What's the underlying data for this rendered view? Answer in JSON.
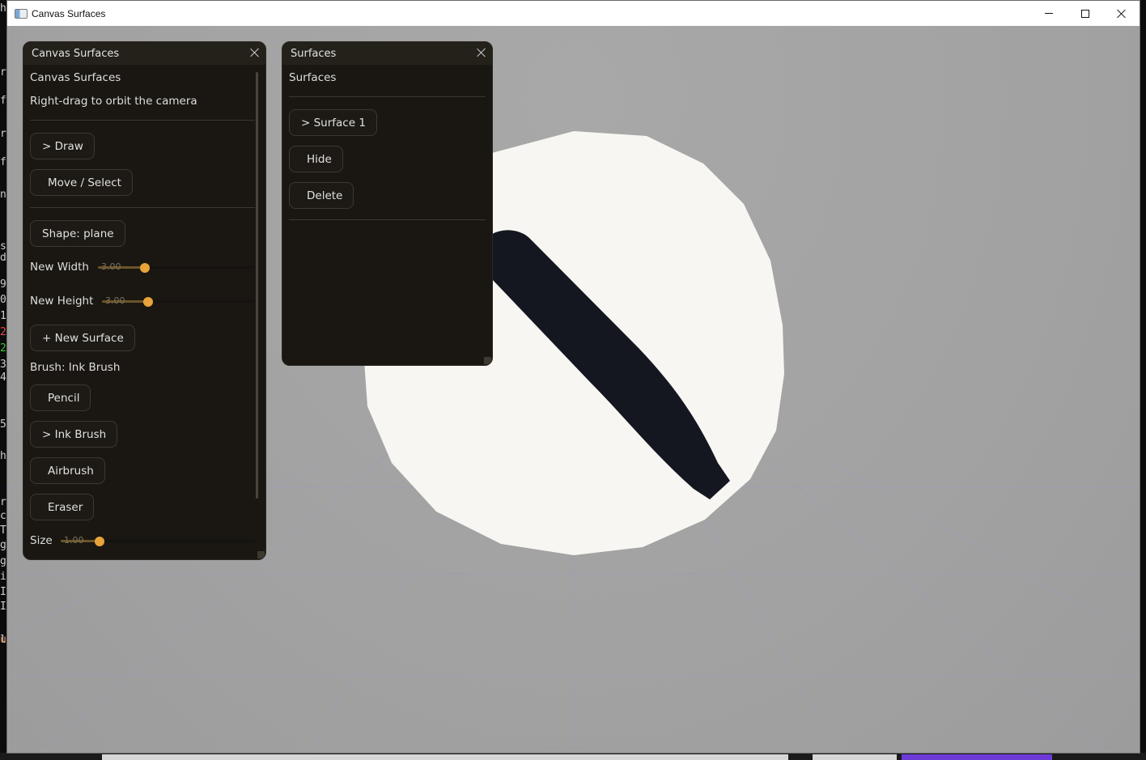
{
  "window": {
    "title": "Canvas Surfaces"
  },
  "background_terminal": {
    "glyphs": [
      {
        "text": "h",
        "color": "#cfcfcf"
      },
      {
        "text": "r",
        "color": "#cfcfcf"
      },
      {
        "text": "f",
        "color": "#cfcfcf"
      },
      {
        "text": "r",
        "color": "#cfcfcf"
      },
      {
        "text": "f",
        "color": "#cfcfcf"
      },
      {
        "text": "n",
        "color": "#cfcfcf"
      },
      {
        "text": "s",
        "color": "#cfcfcf"
      },
      {
        "text": "d",
        "color": "#cfcfcf"
      },
      {
        "text": "9",
        "color": "#cfcfcf"
      },
      {
        "text": "0",
        "color": "#cfcfcf"
      },
      {
        "text": "1",
        "color": "#cfcfcf"
      },
      {
        "text": "2",
        "color": "#e24b4b"
      },
      {
        "text": "2",
        "color": "#37c837"
      },
      {
        "text": "3",
        "color": "#cfcfcf"
      },
      {
        "text": "4",
        "color": "#cfcfcf"
      },
      {
        "text": "5",
        "color": "#cfcfcf"
      },
      {
        "text": "h",
        "color": "#cfcfcf"
      },
      {
        "text": "r",
        "color": "#cfcfcf"
      },
      {
        "text": "c",
        "color": "#cfcfcf"
      },
      {
        "text": "T",
        "color": "#cfcfcf"
      },
      {
        "text": "g",
        "color": "#cfcfcf"
      },
      {
        "text": "g",
        "color": "#cfcfcf"
      },
      {
        "text": "i",
        "color": "#cfcfcf"
      },
      {
        "text": "I",
        "color": "#cfcfcf"
      },
      {
        "text": "I",
        "color": "#cfcfcf"
      },
      {
        "text": "l",
        "color": "#cfcfcf"
      },
      {
        "text": "u",
        "color": "#e0a070"
      }
    ]
  },
  "canvas_panel": {
    "header_title": "Canvas Surfaces",
    "heading": "Canvas Surfaces",
    "hint": "Right-drag to orbit the camera",
    "mode_buttons": {
      "draw": "> Draw",
      "move_select": "Move / Select"
    },
    "shape_button": "Shape: plane",
    "new_width": {
      "label": "New Width",
      "value": 3.0,
      "value_text": "3.00",
      "min": 0,
      "max": 10
    },
    "new_height": {
      "label": "New Height",
      "value": 3.0,
      "value_text": "3.00",
      "min": 0,
      "max": 10
    },
    "new_surface_button": "+ New Surface",
    "brush_label": "Brush: Ink Brush",
    "brushes": {
      "pencil": "Pencil",
      "ink_brush": "> Ink Brush",
      "airbrush": "Airbrush",
      "eraser": "Eraser"
    },
    "size": {
      "label": "Size",
      "value": 1.0,
      "value_text": "1.00",
      "min": 0,
      "max": 5
    }
  },
  "surfaces_panel": {
    "header_title": "Surfaces",
    "heading": "Surfaces",
    "surface_item": "> Surface 1",
    "hide_button": "Hide",
    "delete_button": "Delete"
  },
  "colors": {
    "accent": "#e8a43a",
    "panel_bg": "#1a1712",
    "viewport_bg": "#a3a3a3",
    "surface_fill": "#f7f6f2",
    "stroke_ink": "#141620",
    "grid_lines": "#9d9fb3"
  }
}
